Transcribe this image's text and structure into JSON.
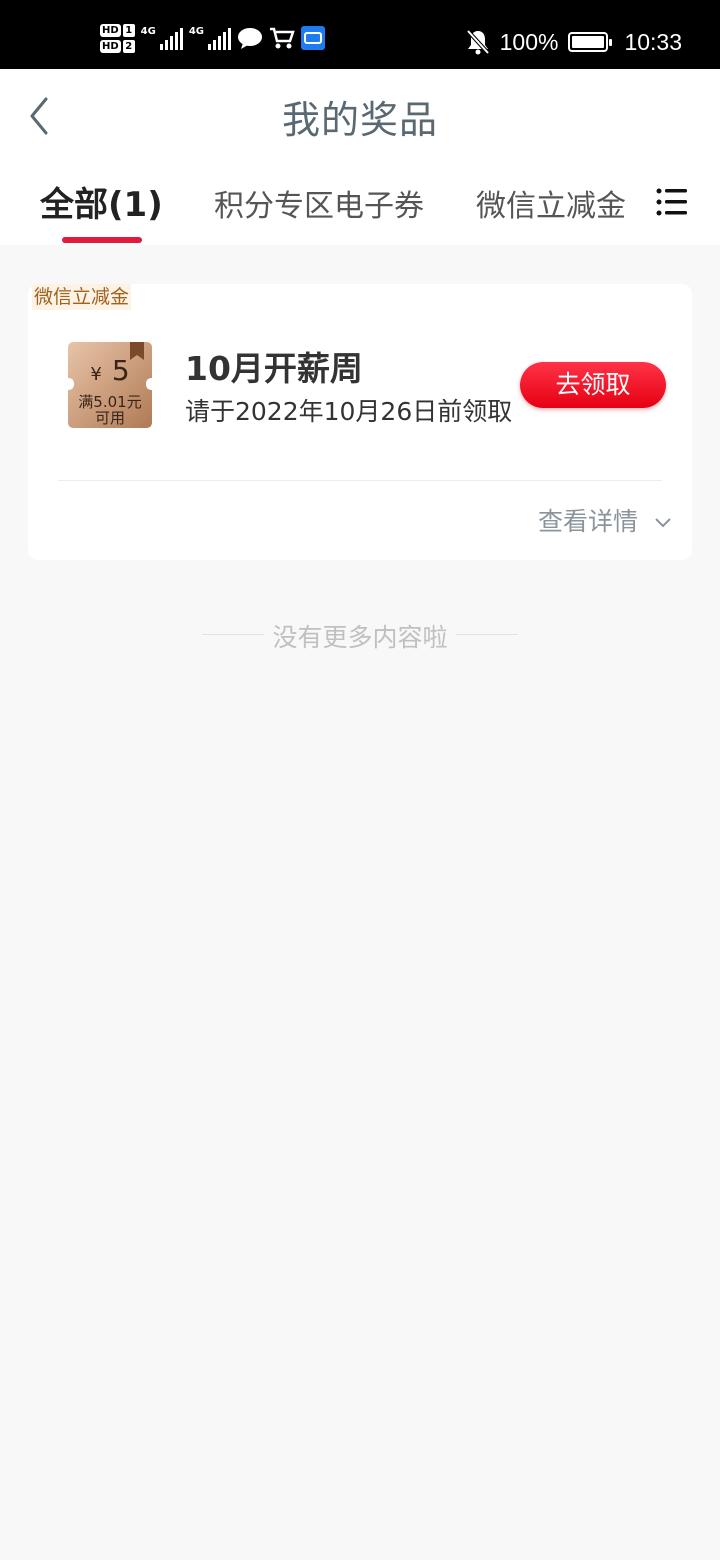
{
  "status_bar": {
    "hd1": "HD",
    "sim1": "1",
    "hd2": "HD",
    "sim2": "2",
    "net1": "4G",
    "net2": "4G",
    "battery": "100%",
    "time": "10:33",
    "icons": [
      "message-icon",
      "cart-icon",
      "app-icon",
      "mute-bell-icon",
      "battery-icon"
    ]
  },
  "header": {
    "title": "我的奖品",
    "back_icon": "chevron-left-icon"
  },
  "tabs": [
    {
      "label": "全部(1)",
      "active": true
    },
    {
      "label": "积分专区电子券",
      "active": false
    },
    {
      "label": "微信立减金",
      "active": false
    }
  ],
  "tab_menu_icon": "list-menu-icon",
  "prizes": [
    {
      "tag": "微信立减金",
      "coupon": {
        "currency": "¥",
        "amount": "5",
        "condition_line1": "满5.01元",
        "condition_line2": "可用"
      },
      "name": "10月开薪周",
      "deadline": "请于2022年10月26日前领取",
      "action_label": "去领取",
      "details_label": "查看详情"
    }
  ],
  "end_note": "没有更多内容啦",
  "colors": {
    "accent_red": "#e21b3c",
    "button_red": "#e60012",
    "title_color": "#5a6872",
    "tag_color": "#a0621c"
  }
}
